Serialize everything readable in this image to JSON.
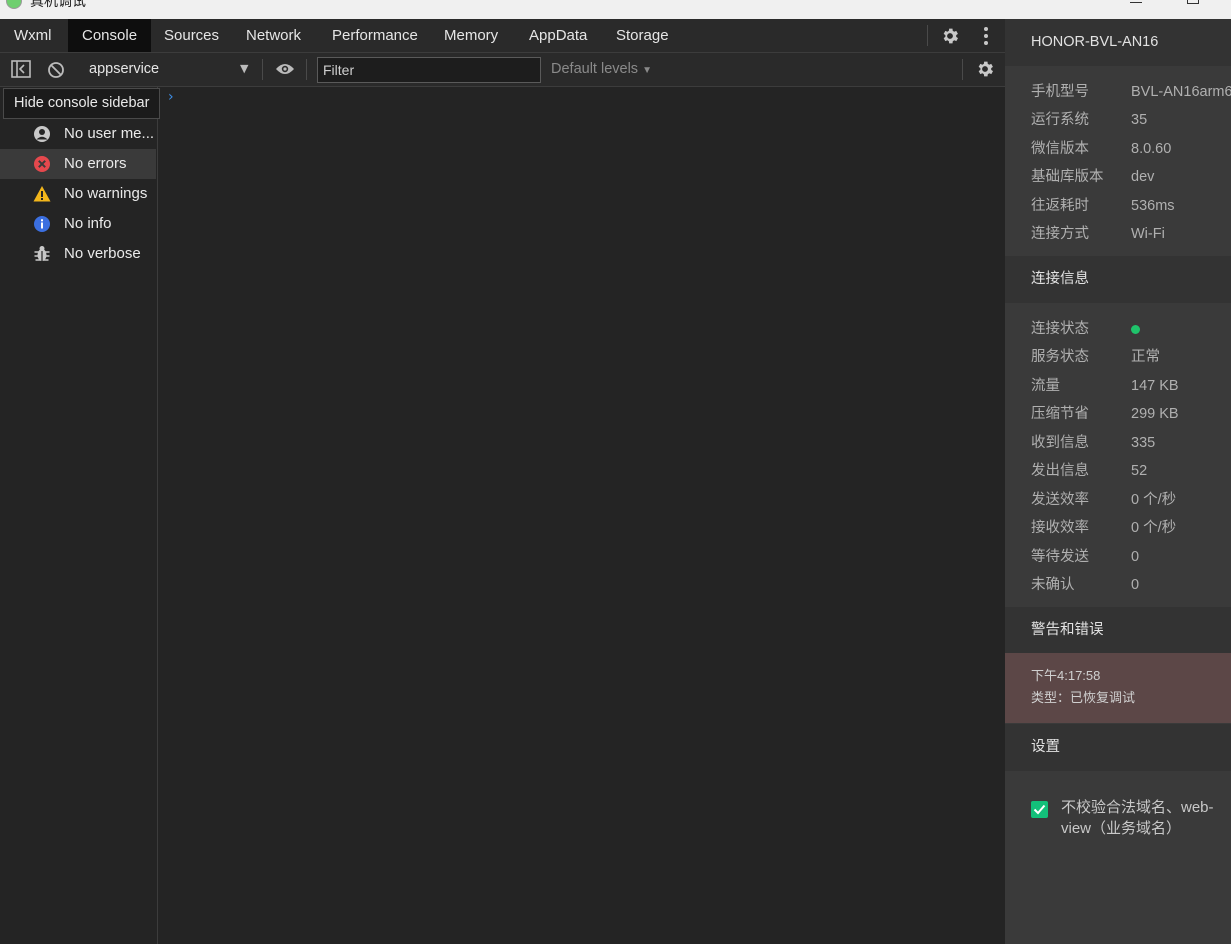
{
  "window": {
    "title": "真机调试"
  },
  "tabs": [
    {
      "label": "Wxml"
    },
    {
      "label": "Console"
    },
    {
      "label": "Sources"
    },
    {
      "label": "Network"
    },
    {
      "label": "Performance"
    },
    {
      "label": "Memory"
    },
    {
      "label": "AppData"
    },
    {
      "label": "Storage"
    }
  ],
  "toolbar": {
    "context": "appservice",
    "filter_placeholder": "Filter",
    "levels": "Default levels"
  },
  "sidebar": {
    "tooltip": "Hide console sidebar",
    "items": [
      {
        "label": "No user me...",
        "icon": "user-icon"
      },
      {
        "label": "No errors",
        "icon": "error-icon"
      },
      {
        "label": "No warnings",
        "icon": "warning-icon"
      },
      {
        "label": "No info",
        "icon": "info-icon"
      },
      {
        "label": "No verbose",
        "icon": "bug-icon"
      }
    ]
  },
  "device": {
    "name": "HONOR-BVL-AN16",
    "rows": [
      {
        "k": "手机型号",
        "v": "BVL-AN16arm6"
      },
      {
        "k": "运行系统",
        "v": "35"
      },
      {
        "k": "微信版本",
        "v": "8.0.60"
      },
      {
        "k": "基础库版本",
        "v": "dev"
      },
      {
        "k": "往返耗时",
        "v": "536ms"
      },
      {
        "k": "连接方式",
        "v": "Wi-Fi"
      }
    ]
  },
  "connection": {
    "title": "连接信息",
    "status_label": "连接状态",
    "status_color": "#1fc36b",
    "rows": [
      {
        "k": "服务状态",
        "v": "正常"
      },
      {
        "k": "流量",
        "v": "147 KB"
      },
      {
        "k": "压缩节省",
        "v": "299 KB"
      },
      {
        "k": "收到信息",
        "v": "335"
      },
      {
        "k": "发出信息",
        "v": "52"
      },
      {
        "k": "发送效率",
        "v": "0 个/秒"
      },
      {
        "k": "接收效率",
        "v": "0 个/秒"
      },
      {
        "k": "等待发送",
        "v": "0"
      },
      {
        "k": "未确认",
        "v": "0"
      }
    ]
  },
  "warnings": {
    "title": "警告和错误",
    "time": "下午4:17:58",
    "type": "类型：已恢复调试"
  },
  "settings": {
    "title": "设置",
    "checkbox_label": "不校验合法域名、web-view（业务域名）",
    "checkbox_checked": true
  }
}
